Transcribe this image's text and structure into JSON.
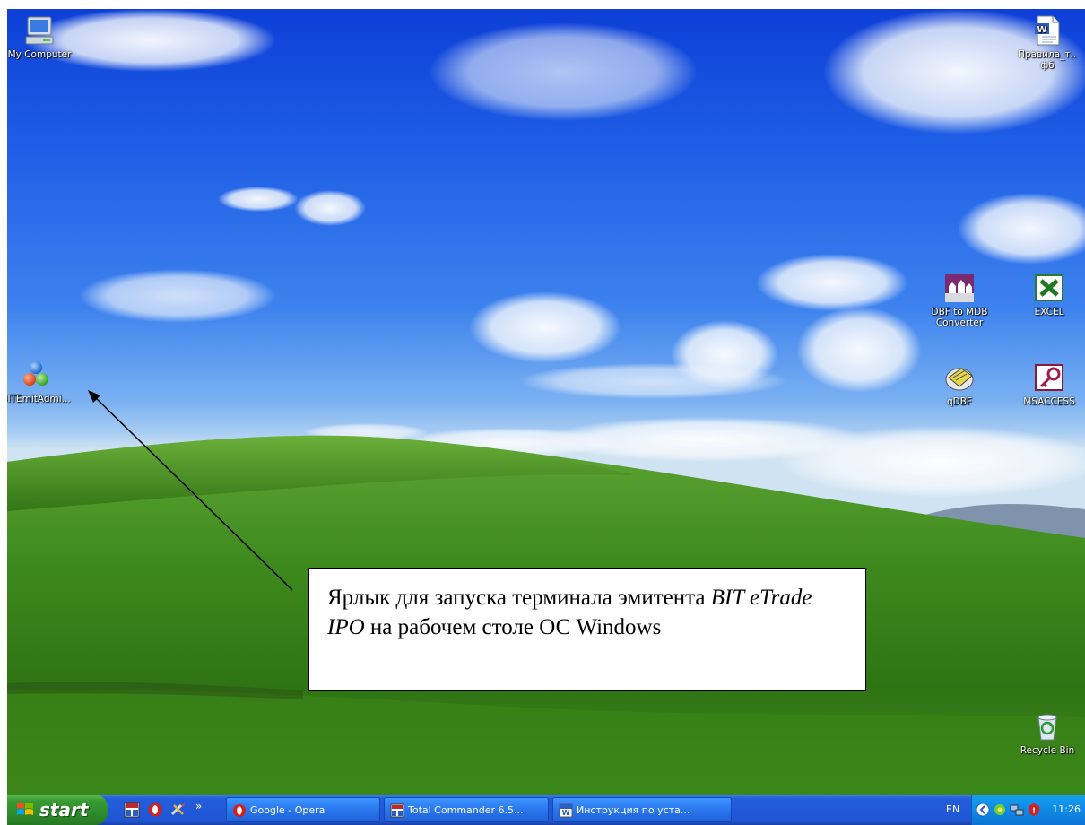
{
  "desktop": {
    "icons": [
      {
        "label": "My Computer"
      },
      {
        "label": "Правила_т... фб"
      },
      {
        "label": "DBF to MDB Converter"
      },
      {
        "label": "EXCEL"
      },
      {
        "label": "qDBF"
      },
      {
        "label": "MSACCESS"
      },
      {
        "label": "BITEmitAdmi..."
      },
      {
        "label": "Recycle Bin"
      }
    ]
  },
  "callout": {
    "lead": "Ярлык для запуска терминала эмитента ",
    "product": "BIT eTrade IPO",
    "tail": " на рабочем столе ОС Windows"
  },
  "taskbar": {
    "start_label": "start",
    "quick_launch_more": "»",
    "tasks": [
      {
        "label": "Google - Opera",
        "icon": "opera-icon"
      },
      {
        "label": "Total Commander 6.5...",
        "icon": "total-commander-icon"
      },
      {
        "label": "Инструкция по уста...",
        "icon": "word-document-icon"
      }
    ],
    "language": "EN",
    "clock": "11:26"
  }
}
